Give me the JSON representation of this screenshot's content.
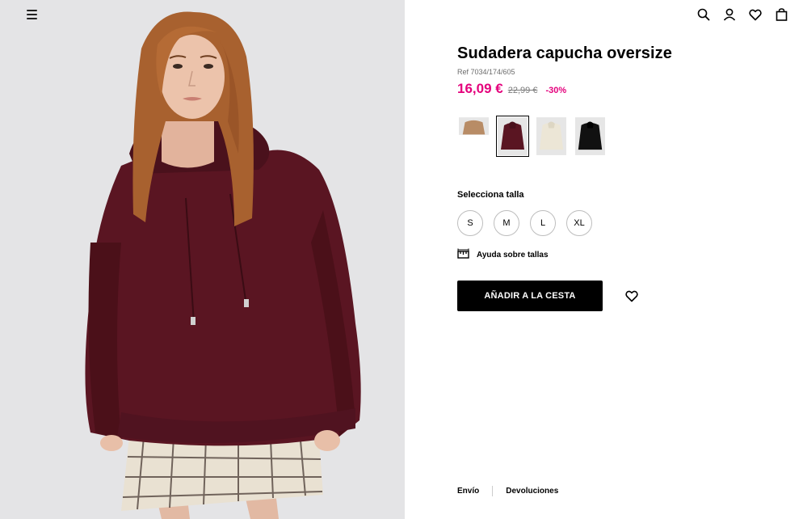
{
  "header": {
    "menu_icon": "hamburger-icon",
    "icons": [
      "search-icon",
      "user-icon",
      "heart-icon",
      "bag-icon"
    ]
  },
  "product": {
    "title": "Sudadera capucha oversize",
    "ref": "Ref 7034/174/605",
    "price": "16,09 €",
    "old_price": "22,99 €",
    "discount": "-30%",
    "colors": [
      {
        "name": "camel",
        "hex": "#b88c66",
        "selected": false
      },
      {
        "name": "burgundy",
        "hex": "#5a1522",
        "selected": true
      },
      {
        "name": "cream",
        "hex": "#ece6d6",
        "selected": false
      },
      {
        "name": "black",
        "hex": "#111111",
        "selected": false
      }
    ]
  },
  "sizes": {
    "label": "Selecciona talla",
    "options": [
      "S",
      "M",
      "L",
      "XL"
    ]
  },
  "size_help": {
    "label": "Ayuda sobre tallas",
    "icon": "ruler-icon"
  },
  "cart": {
    "button_label": "AÑADIR A LA CESTA"
  },
  "footer": {
    "shipping": "Envío",
    "returns": "Devoluciones"
  },
  "colors": {
    "accent": "#e4007c",
    "hoodie": "#5a1522",
    "background": "#e4e4e6"
  }
}
